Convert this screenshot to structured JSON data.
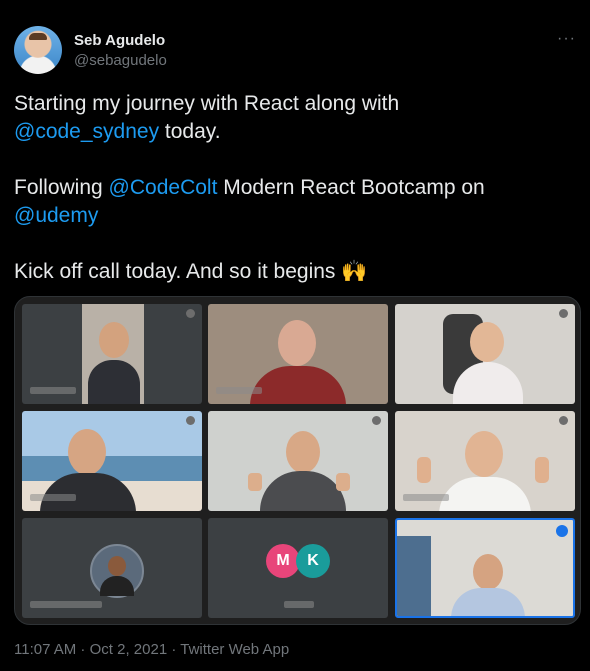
{
  "author": {
    "name": "Seb Agudelo",
    "handle": "@sebagudelo"
  },
  "tweet": {
    "line1_text": "Starting my journey with React along with",
    "line2_mention": "@code_sydney",
    "line2_text": " today.",
    "line3_text": "Following ",
    "line3_mention": "@CodeColt",
    "line3_text2": " Modern React Bootcamp on",
    "line4_mention": "@udemy",
    "line5_text": "Kick off call today. And so it begins 🙌"
  },
  "video_call": {
    "avatars": {
      "first": "M",
      "second": "K"
    },
    "colors": {
      "tile_bg": "#3c4043",
      "m_circle": "#e8457a",
      "k_circle": "#1a9c9b",
      "active_border": "#1a73e8"
    }
  },
  "footer": {
    "time": "11:07 AM",
    "date": "Oct 2, 2021",
    "source": "Twitter Web App",
    "sep": " · "
  },
  "more_label": "···"
}
